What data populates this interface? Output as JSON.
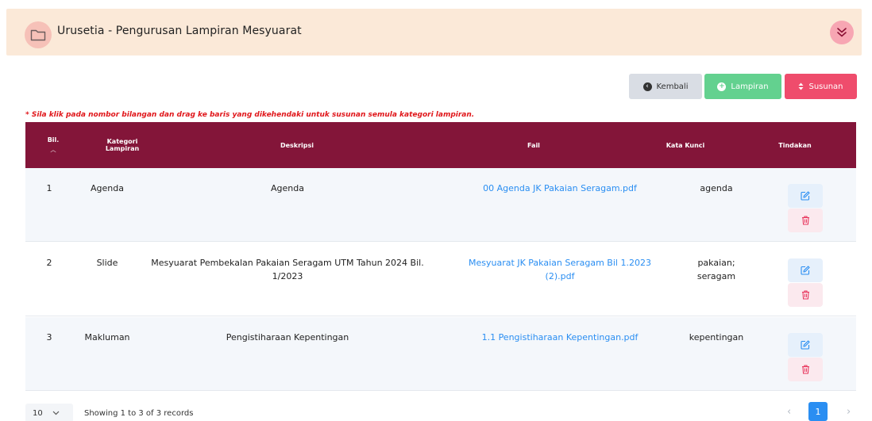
{
  "panel": {
    "title": "Urusetia - Pengurusan Lampiran Mesyuarat",
    "accent": "#831539"
  },
  "toolbar": {
    "back_label": "Kembali",
    "attachment_label": "Lampiran",
    "order_label": "Susunan"
  },
  "note": "* Sila klik pada nombor bilangan dan drag ke baris yang dikehendaki untuk susunan semula kategori lampiran.",
  "table": {
    "headers": {
      "bil": "Bil.",
      "kategori_1": "Kategori",
      "kategori_2": "Lampiran",
      "deskripsi": "Deskripsi",
      "fail": "Fail",
      "kata_kunci": "Kata Kunci",
      "tindakan": "Tindakan"
    },
    "rows": [
      {
        "bil": "1",
        "kategori": "Agenda",
        "deskripsi_1": "Agenda",
        "deskripsi_2": "",
        "fail_1": "00 Agenda JK Pakaian Seragam.pdf",
        "fail_2": "",
        "kata_kunci_1": "agenda",
        "kata_kunci_2": ""
      },
      {
        "bil": "2",
        "kategori": "Slide",
        "deskripsi_1": "Mesyuarat Pembekalan Pakaian Seragam UTM Tahun 2024 Bil.",
        "deskripsi_2": "1/2023",
        "fail_1": "Mesyuarat JK Pakaian Seragam Bil 1.2023",
        "fail_2": "(2).pdf",
        "kata_kunci_1": "pakaian;",
        "kata_kunci_2": "seragam"
      },
      {
        "bil": "3",
        "kategori": "Makluman",
        "deskripsi_1": "Pengistiharaan Kepentingan",
        "deskripsi_2": "",
        "fail_1": "1.1 Pengistiharaan Kepentingan.pdf",
        "fail_2": "",
        "kata_kunci_1": "kepentingan",
        "kata_kunci_2": ""
      }
    ]
  },
  "footer": {
    "per_page": "10",
    "showing": "Showing 1 to 3 of 3 records",
    "current_page": "1"
  },
  "icons": {
    "folder": "folder-icon",
    "collapse": "chevron-double-down-icon",
    "back": "arrow-left-circle-icon",
    "add": "plus-circle-icon",
    "sort": "sort-icon",
    "edit": "edit-icon",
    "delete": "trash-icon"
  }
}
